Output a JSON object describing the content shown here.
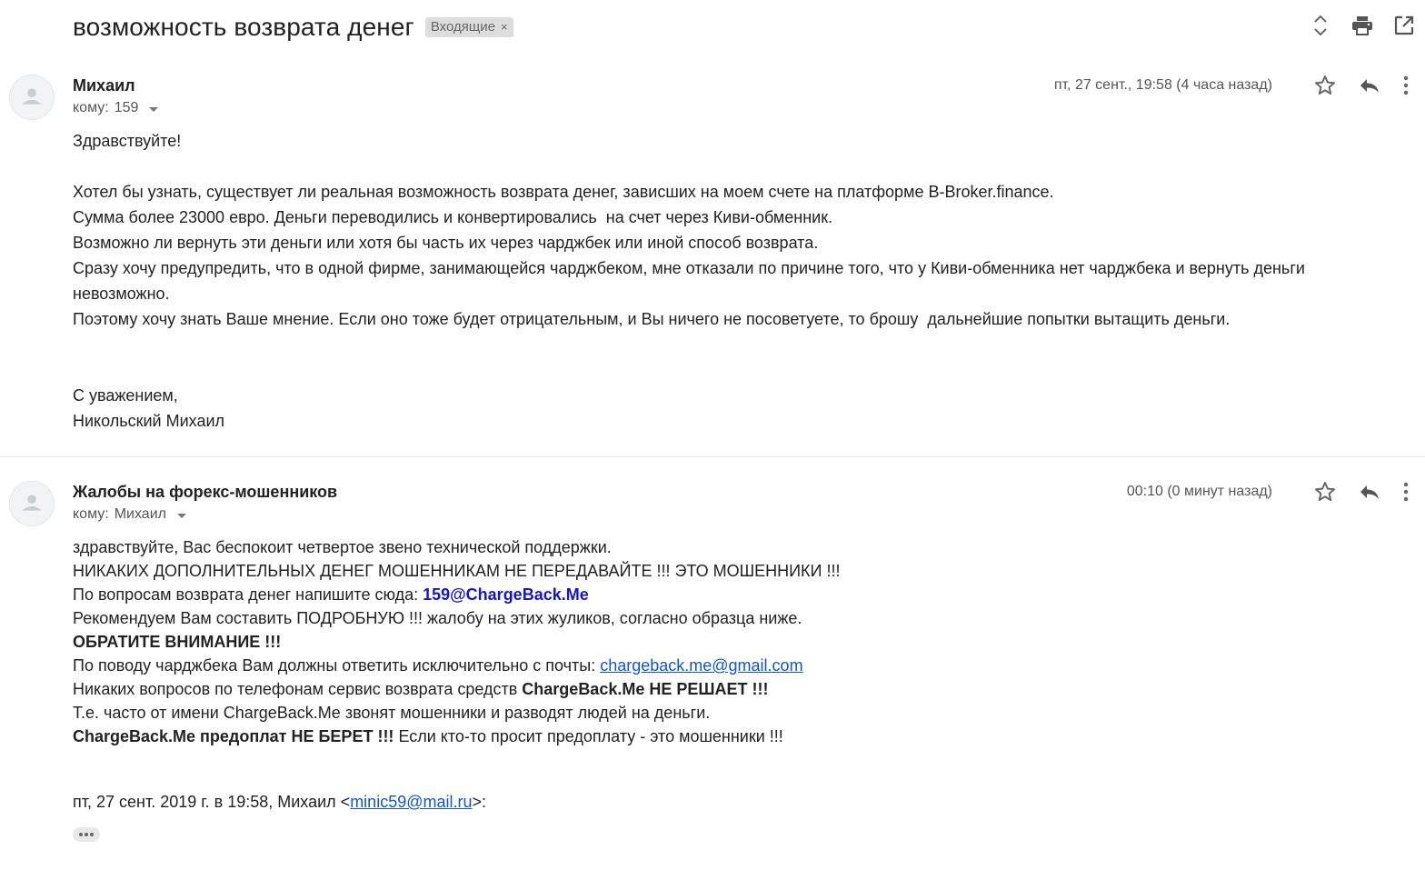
{
  "thread": {
    "subject": "возможность возврата денег",
    "label": "Входящие",
    "label_remove": "×"
  },
  "toolbar_icons": [
    "expand-collapse-icon",
    "print-icon",
    "open-new-window-icon"
  ],
  "messages": [
    {
      "sender": "Михаил",
      "to_prefix": "кому:",
      "to": "159",
      "date": "пт, 27 сент., 19:58 (4 часа назад)",
      "body": [
        "Здравствуйте!",
        "",
        "Хотел бы узнать, существует ли реальная возможность возврата денег, зависших на моем счете на платформе B-Broker.finance.",
        "Сумма более 23000 евро. Деньги переводились и конвертировались  на счет через Киви-обменник.",
        "Возможно ли вернуть эти деньги или хотя бы часть их через чарджбек или иной способ возврата.",
        "Сразу хочу предупредить, что в одной фирме, занимающейся чарджбеком, мне отказали по причине того, что у Киви-обменника нет чарджбека и вернуть деньги",
        "невозможно.",
        "Поэтому хочу знать Ваше мнение. Если оно тоже будет отрицательным, и Вы ничего не посоветуете, то брошу  дальнейшие попытки вытащить деньги.",
        "",
        "",
        "С уважением,",
        "Никольский Михаил"
      ]
    },
    {
      "sender": "Жалобы на форекс-мошенников",
      "to_prefix": "кому:",
      "to": "Михаил",
      "date": "00:10 (0 минут назад)",
      "lines": {
        "l1": "здравствуйте, Вас беспокоит четвертое звено технической поддержки.",
        "l2": "НИКАКИХ ДОПОЛНИТЕЛЬНЫХ ДЕНЕГ МОШЕННИКАМ НЕ ПЕРЕДАВАЙТЕ !!! ЭТО МОШЕННИКИ !!!",
        "l3_text": "По вопросам возврата денег напишите сюда: ",
        "l3_email": "159@ChargeBack.Me",
        "l4": "Рекомендуем Вам составить ПОДРОБНУЮ !!! жалобу на этих жуликов, согласно образца ниже.",
        "l5": "ОБРАТИТЕ ВНИМАНИЕ !!!",
        "l6_text": "По поводу чарджбека Вам должны ответить исключительно с почты: ",
        "l6_link": "chargeback.me@gmail.com",
        "l7_text": "Никаких вопросов по телефонам сервис возврата средств ",
        "l7_bold": "ChargeBack.Me НЕ РЕШАЕТ !!!",
        "l8": "Т.е. часто от имени ChargeBack.Me звонят мошенники и разводят людей на деньги.",
        "l9_bold": "ChargeBack.Me предоплат НЕ БЕРЕТ !!!",
        "l9_text": " Если кто-то просит предоплату - это мошенники !!!",
        "quote_prefix": "пт, 27 сент. 2019 г. в 19:58, Михаил <",
        "quote_email": "minic59@mail.ru",
        "quote_suffix": ">:"
      }
    }
  ],
  "message_icons": [
    "star-icon",
    "reply-icon",
    "more-vert-icon"
  ]
}
